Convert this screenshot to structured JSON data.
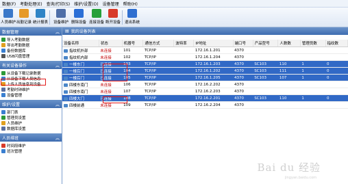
{
  "menu": [
    "数据(F)",
    "考勤处理(E)",
    "查询/打印(S)",
    "维护/设置(O)",
    "设备管理",
    "帮助(H)"
  ],
  "toolbar": [
    {
      "label": "人员维护",
      "icon": "people-icon",
      "color": "#3a78c9"
    },
    {
      "label": "出勤记录",
      "icon": "record-icon",
      "color": "#e69a28"
    },
    {
      "label": "统计报表",
      "icon": "report-icon",
      "color": "#2f84c6"
    },
    {
      "label": "设备维护",
      "icon": "device-icon",
      "color": "#4f6fa8"
    },
    {
      "label": "删除设备",
      "icon": "delete-icon",
      "color": "#2b6fd6"
    },
    {
      "label": "连接设备",
      "icon": "connect-icon",
      "color": "#26a03a"
    },
    {
      "label": "断开设备",
      "icon": "disconnect-icon",
      "color": "#d83a2a"
    },
    {
      "label": "退出系统",
      "icon": "exit-icon",
      "color": "#2f6fd0"
    }
  ],
  "sidebar": {
    "sections": [
      {
        "title": "数据管理",
        "items": [
          {
            "label": "导入考勤数据",
            "icon": "import-icon",
            "color": "#2d9a3a"
          },
          {
            "label": "导出考勤数据",
            "icon": "export-icon",
            "color": "#e0a020"
          },
          {
            "label": "备份数据库",
            "icon": "backup-icon",
            "color": "#3a7fd0"
          },
          {
            "label": "USB闪盘管理",
            "icon": "usb-icon",
            "color": "#555555"
          }
        ]
      },
      {
        "title": "有关设备操作",
        "items": [
          {
            "label": "从设备下载记录数据",
            "icon": "download-icon",
            "color": "#2d9a3a"
          },
          {
            "label": "从设备下载人员信息",
            "icon": "download-user-icon",
            "color": "#3a7fd0"
          },
          {
            "label": "上传人员信息到设备",
            "icon": "upload-icon",
            "color": "#e0a020"
          },
          {
            "label": "考勤时钟维护",
            "icon": "clock-icon",
            "color": "#5a6fa0"
          },
          {
            "label": "设备管理",
            "icon": "device-icon",
            "color": "#3a7fd0"
          }
        ]
      },
      {
        "title": "维护/设置",
        "items": [
          {
            "label": "部门表",
            "icon": "dept-icon",
            "color": "#3a7fd0"
          },
          {
            "label": "管理员设置",
            "icon": "admin-icon",
            "color": "#2d9a3a"
          },
          {
            "label": "人员维护",
            "icon": "user-icon",
            "color": "#e0a020"
          },
          {
            "label": "数据库设置",
            "icon": "database-icon",
            "color": "#5a6fa0"
          }
        ]
      },
      {
        "title": "人员排班",
        "items": [
          {
            "label": "时间段维护",
            "icon": "time-icon",
            "color": "#d83a2a"
          },
          {
            "label": "班次管理",
            "icon": "shift-icon",
            "color": "#3a7fd0"
          }
        ]
      }
    ]
  },
  "main": {
    "title": "我的设备列表",
    "columns": [
      "设备名称",
      "状态",
      "机器号",
      "通信方式",
      "波特率",
      "IP地址",
      "端口号",
      "产品型号",
      "人数数",
      "管理员数",
      "指纹数"
    ],
    "rows": [
      {
        "name": "指纹机外部",
        "status": "未连接",
        "machine": "101",
        "comm": "TCP/IP",
        "baud": "",
        "ip": "172.16.1.201",
        "port": "4370",
        "model": "",
        "users": "",
        "admins": "",
        "fp": "",
        "selected": false,
        "online": false
      },
      {
        "name": "指纹机内部",
        "status": "未连接",
        "machine": "102",
        "comm": "TCP/IP",
        "baud": "",
        "ip": "172.16.1.204",
        "port": "4370",
        "model": "",
        "users": "",
        "admins": "",
        "fp": "",
        "selected": false,
        "online": false
      },
      {
        "name": "一楼东门",
        "status": "已连接",
        "machine": "103",
        "comm": "TCP/IP",
        "baud": "",
        "ip": "172.16.1.203",
        "port": "4370",
        "model": "SC103",
        "users": "110",
        "admins": "1",
        "fp": "0",
        "selected": true,
        "online": true
      },
      {
        "name": "一楼后门",
        "status": "已连接",
        "machine": "104",
        "comm": "TCP/IP",
        "baud": "",
        "ip": "172.16.1.202",
        "port": "4370",
        "model": "SC103",
        "users": "111",
        "admins": "1",
        "fp": "0",
        "selected": true,
        "online": true
      },
      {
        "name": "一楼后门",
        "status": "已连接",
        "machine": "105",
        "comm": "TCP/IP",
        "baud": "",
        "ip": "172.16.1.205",
        "port": "4370",
        "model": "SC103",
        "users": "107",
        "admins": "1",
        "fp": "0",
        "selected": true,
        "online": true
      },
      {
        "name": "四楼东南门",
        "status": "未连接",
        "machine": "106",
        "comm": "TCP/IP",
        "baud": "",
        "ip": "172.16.2.202",
        "port": "4370",
        "model": "",
        "users": "",
        "admins": "",
        "fp": "",
        "selected": false,
        "online": false
      },
      {
        "name": "四楼东南门",
        "status": "未连接",
        "machine": "107",
        "comm": "TCP/IP",
        "baud": "",
        "ip": "172.16.2.203",
        "port": "4370",
        "model": "",
        "users": "",
        "admins": "",
        "fp": "",
        "selected": false,
        "online": false
      },
      {
        "name": "四楼大门",
        "status": "已连接",
        "machine": "108",
        "comm": "TCP/IP",
        "baud": "",
        "ip": "172.16.2.201",
        "port": "4370",
        "model": "SC103",
        "users": "110",
        "admins": "1",
        "fp": "0",
        "selected": true,
        "online": true
      },
      {
        "name": "四楼前通",
        "status": "未连接",
        "machine": "109",
        "comm": "TCP/IP",
        "baud": "",
        "ip": "172.16.2.204",
        "port": "4370",
        "model": "",
        "users": "",
        "admins": "",
        "fp": "",
        "selected": false,
        "online": false
      }
    ]
  },
  "watermark": {
    "text": "Bai du 经验",
    "sub": "jingyan.baidu.com"
  }
}
